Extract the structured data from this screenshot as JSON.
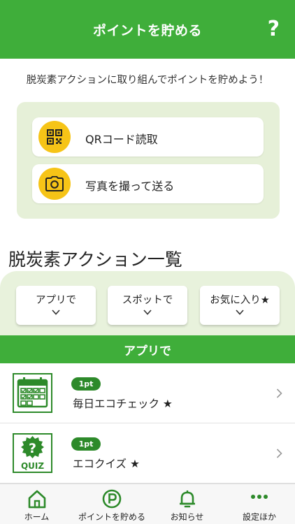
{
  "header": {
    "title": "ポイントを貯める",
    "help_label": "?"
  },
  "intro": {
    "text": "脱炭素アクションに取り組んでポイントを貯めよう！"
  },
  "actions": [
    {
      "label": "QRコード読取",
      "icon": "qr-code-icon"
    },
    {
      "label": "写真を撮って送る",
      "icon": "camera-icon"
    }
  ],
  "section": {
    "title": "脱炭素アクション一覧"
  },
  "filters": [
    {
      "label": "アプリで"
    },
    {
      "label": "スポットで"
    },
    {
      "label": "お気に入り★"
    }
  ],
  "category": {
    "label": "アプリで"
  },
  "items": [
    {
      "points": "1pt",
      "title": "毎日エコチェック ★",
      "icon": "calendar-check-icon"
    },
    {
      "points": "1pt",
      "title": "エコクイズ ★",
      "icon": "quiz-icon",
      "icon_text": "QUIZ"
    }
  ],
  "tabs": [
    {
      "label": "ホーム",
      "icon": "home-icon"
    },
    {
      "label": "ポイントを貯める",
      "icon": "points-icon"
    },
    {
      "label": "お知らせ",
      "icon": "bell-icon"
    },
    {
      "label": "設定ほか",
      "icon": "more-icon"
    }
  ],
  "colors": {
    "brand_green": "#3fae3a",
    "dark_green": "#2d8a2a",
    "accent_yellow": "#f6c417",
    "panel_green": "#e6f0d8"
  }
}
